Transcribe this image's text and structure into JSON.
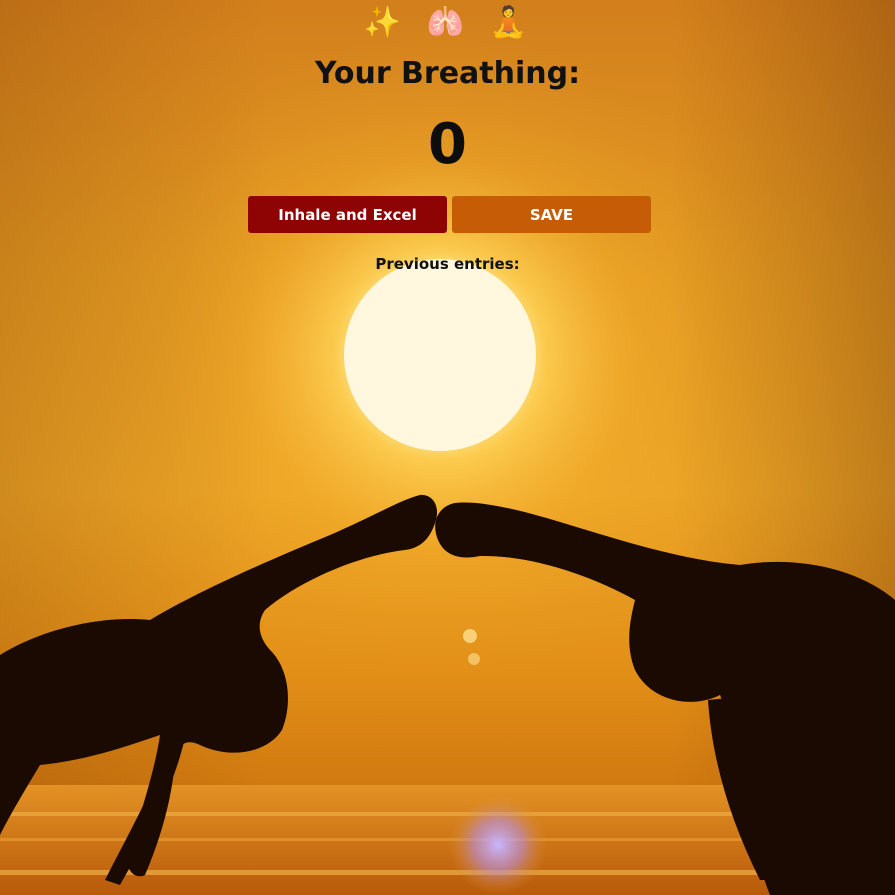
{
  "header": {
    "icons": [
      {
        "name": "sparkles-icon",
        "glyph": "✨"
      },
      {
        "name": "lungs-icon",
        "glyph": "🫁"
      },
      {
        "name": "meditation-icon",
        "glyph": "🧘"
      }
    ],
    "title": "Your Breathing:"
  },
  "counter": {
    "value": "0"
  },
  "actions": {
    "inhale_label": "Inhale and Excel",
    "save_label": "SAVE"
  },
  "entries": {
    "heading": "Previous entries:",
    "items": []
  },
  "colors": {
    "inhale_button": "#8e0404",
    "save_button": "#c65d06",
    "text": "#111111"
  }
}
